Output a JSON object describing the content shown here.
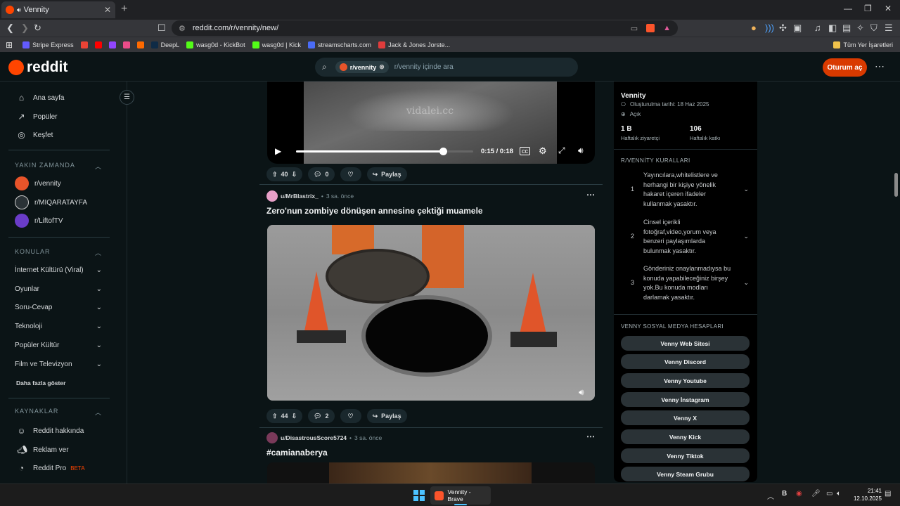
{
  "browser": {
    "tab_title": "Vennity",
    "url": "reddit.com/r/vennity/new/",
    "bookmarks": [
      {
        "label": "Stripe Express",
        "color": "#635bff"
      },
      {
        "label": "",
        "color": "#ea4335"
      },
      {
        "label": "",
        "color": "#ff0000"
      },
      {
        "label": "",
        "color": "#9146ff"
      },
      {
        "label": "",
        "color": "#ea4c89"
      },
      {
        "label": "",
        "color": "#ff6a00"
      },
      {
        "label": "DeepL",
        "color": "#0f2b46"
      },
      {
        "label": "wasg0d - KickBot",
        "color": "#53fc18"
      },
      {
        "label": "wasg0d | Kick",
        "color": "#53fc18"
      },
      {
        "label": "streamscharts.com",
        "color": "#4a6cf7"
      },
      {
        "label": "Jack & Jones Jorste...",
        "color": "#e03c3c"
      }
    ],
    "all_bookmarks": "Tüm Yer İşaretleri"
  },
  "header": {
    "logo_text": "reddit",
    "search_chip": "r/vennity",
    "search_placeholder": "r/vennity içinde ara",
    "login_label": "Oturum aç"
  },
  "sidebar": {
    "nav": [
      {
        "label": "Ana sayfa",
        "icon": "home-icon"
      },
      {
        "label": "Popüler",
        "icon": "popular-icon"
      },
      {
        "label": "Keşfet",
        "icon": "explore-icon"
      }
    ],
    "recent_title": "YAKIN ZAMANDA",
    "recent": [
      {
        "label": "r/vennity",
        "color": "#e8542a"
      },
      {
        "label": "r/MIQARATAYFA",
        "color": "#ffffff"
      },
      {
        "label": "r/LiftofTV",
        "color": "#6a3cc8"
      }
    ],
    "topics_title": "KONULAR",
    "topics": [
      "İnternet Kültürü (Viral)",
      "Oyunlar",
      "Soru-Cevap",
      "Teknoloji",
      "Popüler Kültür",
      "Film ve Televizyon"
    ],
    "more_label": "Daha fazla göster",
    "resources_title": "KAYNAKLAR",
    "resources": [
      {
        "label": "Reddit hakkında",
        "icon": "reddit-icon"
      },
      {
        "label": "Reklam ver",
        "icon": "megaphone-icon"
      },
      {
        "label": "Reddit Pro",
        "icon": "pro-icon",
        "badge": "BETA"
      }
    ]
  },
  "video": {
    "watermark": "vidalei.cc",
    "time": "0:15 / 0:18",
    "progress": 0.83
  },
  "posts": [
    {
      "votes": "40",
      "comments": "0",
      "share": "Paylaş"
    },
    {
      "author": "u/MrBlastrix_",
      "time": "3 sa. önce",
      "title": "Zero'nun zombiye dönüşen annesine çektiği muamele",
      "votes": "44",
      "comments": "2",
      "share": "Paylaş",
      "avatar": "#e8a0c8"
    },
    {
      "author": "u/DisastrousScore5724",
      "time": "3 sa. önce",
      "title": "#camianaberya",
      "avatar": "#7a3a5a"
    }
  ],
  "community": {
    "name": "Vennity",
    "created": "Oluşturulma tarihi: 18 Haz 2025",
    "visibility": "Açık",
    "visitors_value": "1 B",
    "visitors_label": "Haftalık ziyaretçi",
    "contrib_value": "106",
    "contrib_label": "Haftalık katkı",
    "rules_title": "R/VENNİTY KURALLARI",
    "rules": [
      {
        "num": "1",
        "text": "Yayıncılara,whitelistlere ve herhangi bir kişiye yönelik hakaret içeren ifadeler kullanmak yasaktır."
      },
      {
        "num": "2",
        "text": "Cinsel içerikli fotoğraf,video,yorum veya benzeri paylaşımlarda bulunmak yasaktır."
      },
      {
        "num": "3",
        "text": "Gönderiniz onaylanmadıysa bu konuda yapabileceğiniz birşey yok.Bu konuda modları darlamak yasaktır."
      }
    ],
    "social_title": "VENNY SOSYAL MEDYA HESAPLARI",
    "social": [
      "Venny Web Sitesi",
      "Venny Discord",
      "Venny Youtube",
      "Venny İnstagram",
      "Venny X",
      "Venny Kick",
      "Venny Tiktok",
      "Venny Steam Grubu"
    ]
  },
  "taskbar": {
    "app_label": "Vennity - Brave",
    "time": "21:41",
    "date": "12.10.2025"
  }
}
